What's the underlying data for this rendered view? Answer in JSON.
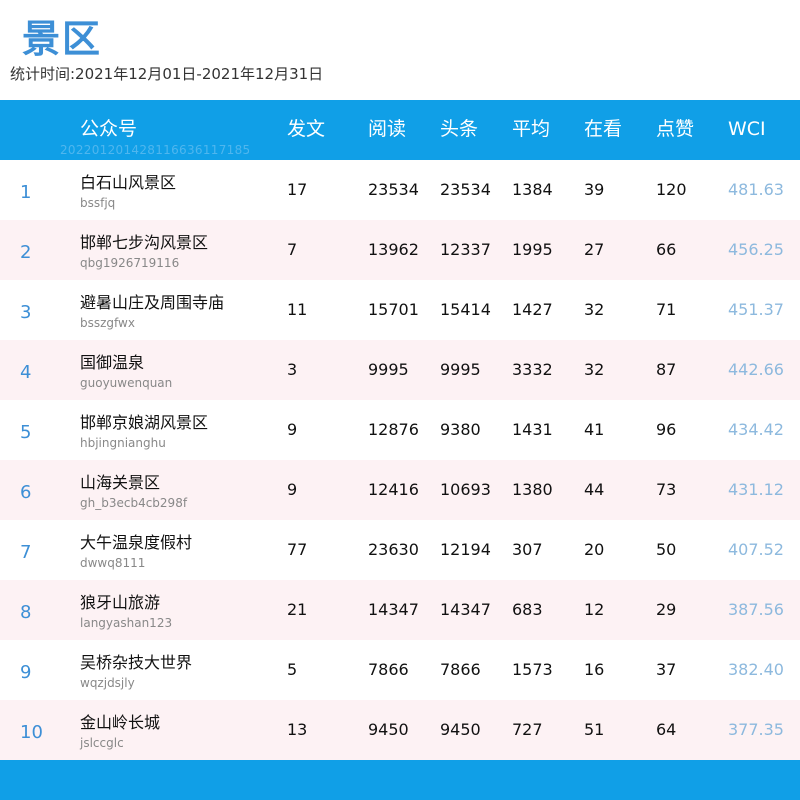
{
  "title": "景区",
  "period": "统计时间:2021年12月01日-2021年12月31日",
  "colors": {
    "header_bg": "#109fe7",
    "title": "#3d8fd6",
    "alt_row": "#fdf2f4",
    "wci": "#8db9de"
  },
  "header": {
    "account": "公众号",
    "posts": "发文",
    "reads": "阅读",
    "headline": "头条",
    "average": "平均",
    "watching": "在看",
    "likes": "点赞",
    "wci": "WCI",
    "watermark": "20220120142811663611718​5"
  },
  "rows": [
    {
      "rank": "1",
      "name": "白石山风景区",
      "account": "bssfjq",
      "posts": "17",
      "reads": "23534",
      "headline": "23534",
      "average": "1384",
      "watching": "39",
      "likes": "120",
      "wci": "481.63"
    },
    {
      "rank": "2",
      "name": "邯郸七步沟风景区",
      "account": "qbg1926719116",
      "posts": "7",
      "reads": "13962",
      "headline": "12337",
      "average": "1995",
      "watching": "27",
      "likes": "66",
      "wci": "456.25"
    },
    {
      "rank": "3",
      "name": "避暑山庄及周围寺庙",
      "account": "bsszgfwx",
      "posts": "11",
      "reads": "15701",
      "headline": "15414",
      "average": "1427",
      "watching": "32",
      "likes": "71",
      "wci": "451.37"
    },
    {
      "rank": "4",
      "name": "国御温泉",
      "account": "guoyuwenquan",
      "posts": "3",
      "reads": "9995",
      "headline": "9995",
      "average": "3332",
      "watching": "32",
      "likes": "87",
      "wci": "442.66"
    },
    {
      "rank": "5",
      "name": "邯郸京娘湖风景区",
      "account": "hbjingnianghu",
      "posts": "9",
      "reads": "12876",
      "headline": "9380",
      "average": "1431",
      "watching": "41",
      "likes": "96",
      "wci": "434.42"
    },
    {
      "rank": "6",
      "name": "山海关景区",
      "account": "gh_b3ecb4cb298f",
      "posts": "9",
      "reads": "12416",
      "headline": "10693",
      "average": "1380",
      "watching": "44",
      "likes": "73",
      "wci": "431.12"
    },
    {
      "rank": "7",
      "name": "大午温泉度假村",
      "account": "dwwq8111",
      "posts": "77",
      "reads": "23630",
      "headline": "12194",
      "average": "307",
      "watching": "20",
      "likes": "50",
      "wci": "407.52"
    },
    {
      "rank": "8",
      "name": "狼牙山旅游",
      "account": "langyashan123",
      "posts": "21",
      "reads": "14347",
      "headline": "14347",
      "average": "683",
      "watching": "12",
      "likes": "29",
      "wci": "387.56"
    },
    {
      "rank": "9",
      "name": "吴桥杂技大世界",
      "account": "wqzjdsjly",
      "posts": "5",
      "reads": "7866",
      "headline": "7866",
      "average": "1573",
      "watching": "16",
      "likes": "37",
      "wci": "382.40"
    },
    {
      "rank": "10",
      "name": "金山岭长城",
      "account": "jslccglc",
      "posts": "13",
      "reads": "9450",
      "headline": "9450",
      "average": "727",
      "watching": "51",
      "likes": "64",
      "wci": "377.35"
    }
  ]
}
